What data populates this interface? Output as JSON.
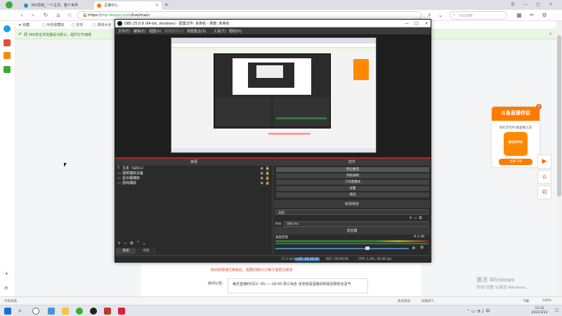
{
  "browser": {
    "tabs": [
      {
        "label": "360导航_一个主页，整个世界"
      },
      {
        "label": "主播中心"
      }
    ],
    "new_tab_glyph": "+",
    "url_scheme": "https://",
    "url_host": "mp.douyu.com",
    "url_path": "/live/main",
    "search_placeholder": "点此搜索",
    "bookmarks": [
      "收藏",
      "手机收藏夹",
      "京东",
      "游戏大全"
    ],
    "notice": "网 360安全浏览器设为默认，提升打开速度",
    "status_left": "今日优选",
    "status_right": [
      "热点资讯",
      "同城天气",
      "下载",
      "100%"
    ]
  },
  "obs": {
    "title": "OBS 25.0.8 (64-bit, windows) - 配置文件: 未命名 - 场景: 未命名",
    "menu": [
      "文件(F)",
      "编辑(E)",
      "视图(V)",
      "停靠部件(D)",
      "场景集合(S)",
      "工具(T)",
      "帮助(H)"
    ],
    "sources_header": "来源",
    "sources": [
      {
        "icon": "T",
        "label": "文本（GDI+）"
      },
      {
        "icon": "▭",
        "label": "视频捕获设备"
      },
      {
        "icon": "▭",
        "label": "显示器捕获"
      },
      {
        "icon": "▭",
        "label": "游戏捕获"
      }
    ],
    "source_tabs": [
      "来源",
      "场景"
    ],
    "controls_header": "控件",
    "controls": [
      "停止推流",
      "开始录制",
      "工作室模式",
      "设置",
      "退出"
    ],
    "transition_header": "转场特效",
    "transition_value": "淡出",
    "duration_label": "时长",
    "duration_value": "300 ms",
    "mixer_header": "混音器",
    "mixer_track": "桌面音频",
    "mixer_level": "-8.3 dB",
    "status": {
      "stream": "LIVE: 00:00:00",
      "rec": "REC: 00:00:00",
      "cpu": "CPU: 1.0%, 30.00 fps",
      "kbps": "12.0 kb/s"
    }
  },
  "promo": {
    "title": "斗鱼直播伴侣",
    "desc": "斜杠老司PC端直播工具",
    "logo_text": "DOUYU",
    "button": "立即下载",
    "close": "×"
  },
  "page": {
    "warning": "房间权限通过审核后，需要间隔10分钟才能再次修改",
    "announce_label": "房间公告:",
    "announce_text": "每天直播时间12: 00——18:00 周三休息 永佳和蛋蛋播间积极回馈粉丝喜气"
  },
  "windows": {
    "activate_title": "激活 Windows",
    "activate_hint": "转到\"设置\"以激活 Windows。",
    "clock_time": "12:32",
    "clock_date": "2022/3/24"
  },
  "colors": {
    "accent_green": "#3a9c3a",
    "douyu_orange": "#ff7a00",
    "obs_dark": "#2b2b2b",
    "warning_red": "#e04b2c"
  }
}
